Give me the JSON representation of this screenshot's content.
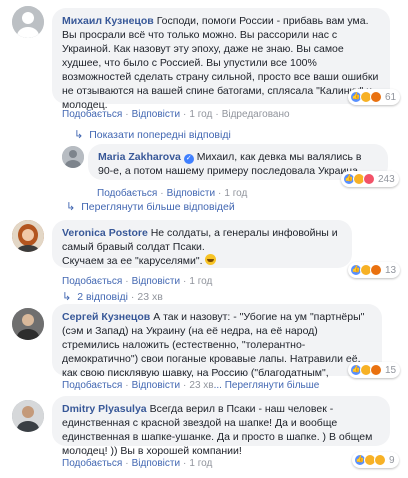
{
  "comments": [
    {
      "author": "Михаил Кузнецов",
      "text": "Господи, помоги России - прибавь вам ума. Вы просрали всё что только можно. Вы рассорили нас с Украиной. Как назовут эту эпоху, даже не знаю. Вы самое худшее, что было с Россией. Вы упустили все 100% возможностей сделать страну сильной, просто все ваши ошибки не отзываются на вашей спине батогами, сплясала \"Калинку\" и молодец.",
      "like": "Подобається",
      "reply": "Відповісти",
      "time": "1 год",
      "edited": "Відредаговано",
      "reactions_count": "61",
      "reactions": [
        "like",
        "haha",
        "angry"
      ],
      "show_prev": "Показати попередні відповіді"
    },
    {
      "author": "Maria Zakharova",
      "text": "Михаил, как девка мы валялись в 90-е, а потом нашему примеру последовала Украина.",
      "like": "Подобається",
      "reply": "Відповісти",
      "time": "1 год",
      "reactions_count": "243",
      "reactions": [
        "like",
        "haha",
        "love"
      ],
      "more_replies": "Переглянути більше відповідей"
    },
    {
      "author": "Veronica Postore",
      "text": "Не солдаты, а генералы инфовойны и самый бравый солдат Псаки.",
      "text2": "Скучаем за ее \"каруселями\".",
      "like": "Подобається",
      "reply": "Відповісти",
      "time": "1 год",
      "reactions_count": "13",
      "reactions": [
        "like",
        "haha",
        "angry"
      ],
      "replies_link": "2 відповіді",
      "replies_time": "23 хв"
    },
    {
      "author": "Сергей Кузнецов",
      "text": "А так и назовут: - \"Убогие на ум \"партнёры\" (сэм и Запад) на Украину (на её недра, на её народ) стремились наложить (естественно, \"толерантно- демократично\") свои поганые кровавые лапы. Натравили её, как свою писклявую шавку, на Россию (\"благодатным\",",
      "see_more": "... Переглянути більше",
      "like": "Подобається",
      "reply": "Відповісти",
      "time": "23 хв",
      "reactions_count": "15",
      "reactions": [
        "like",
        "haha",
        "angry"
      ]
    },
    {
      "author": "Dmitry Plyasulya",
      "text": "Всегда верил в Псаки - наш человек - единственная с красной звездой на шапке! Да и вообще единственная в шапке-ушанке. Да и просто в шапке. ) В общем молодец! )) Вы в хорошей компании!",
      "like": "Подобається",
      "reply": "Відповісти",
      "time": "1 год",
      "reactions_count": "9",
      "reactions": [
        "like",
        "haha",
        "wow"
      ]
    }
  ],
  "colors": {
    "link": "#4267b2",
    "author": "#385898",
    "bubble": "#f2f3f5",
    "meta": "#90949c"
  }
}
